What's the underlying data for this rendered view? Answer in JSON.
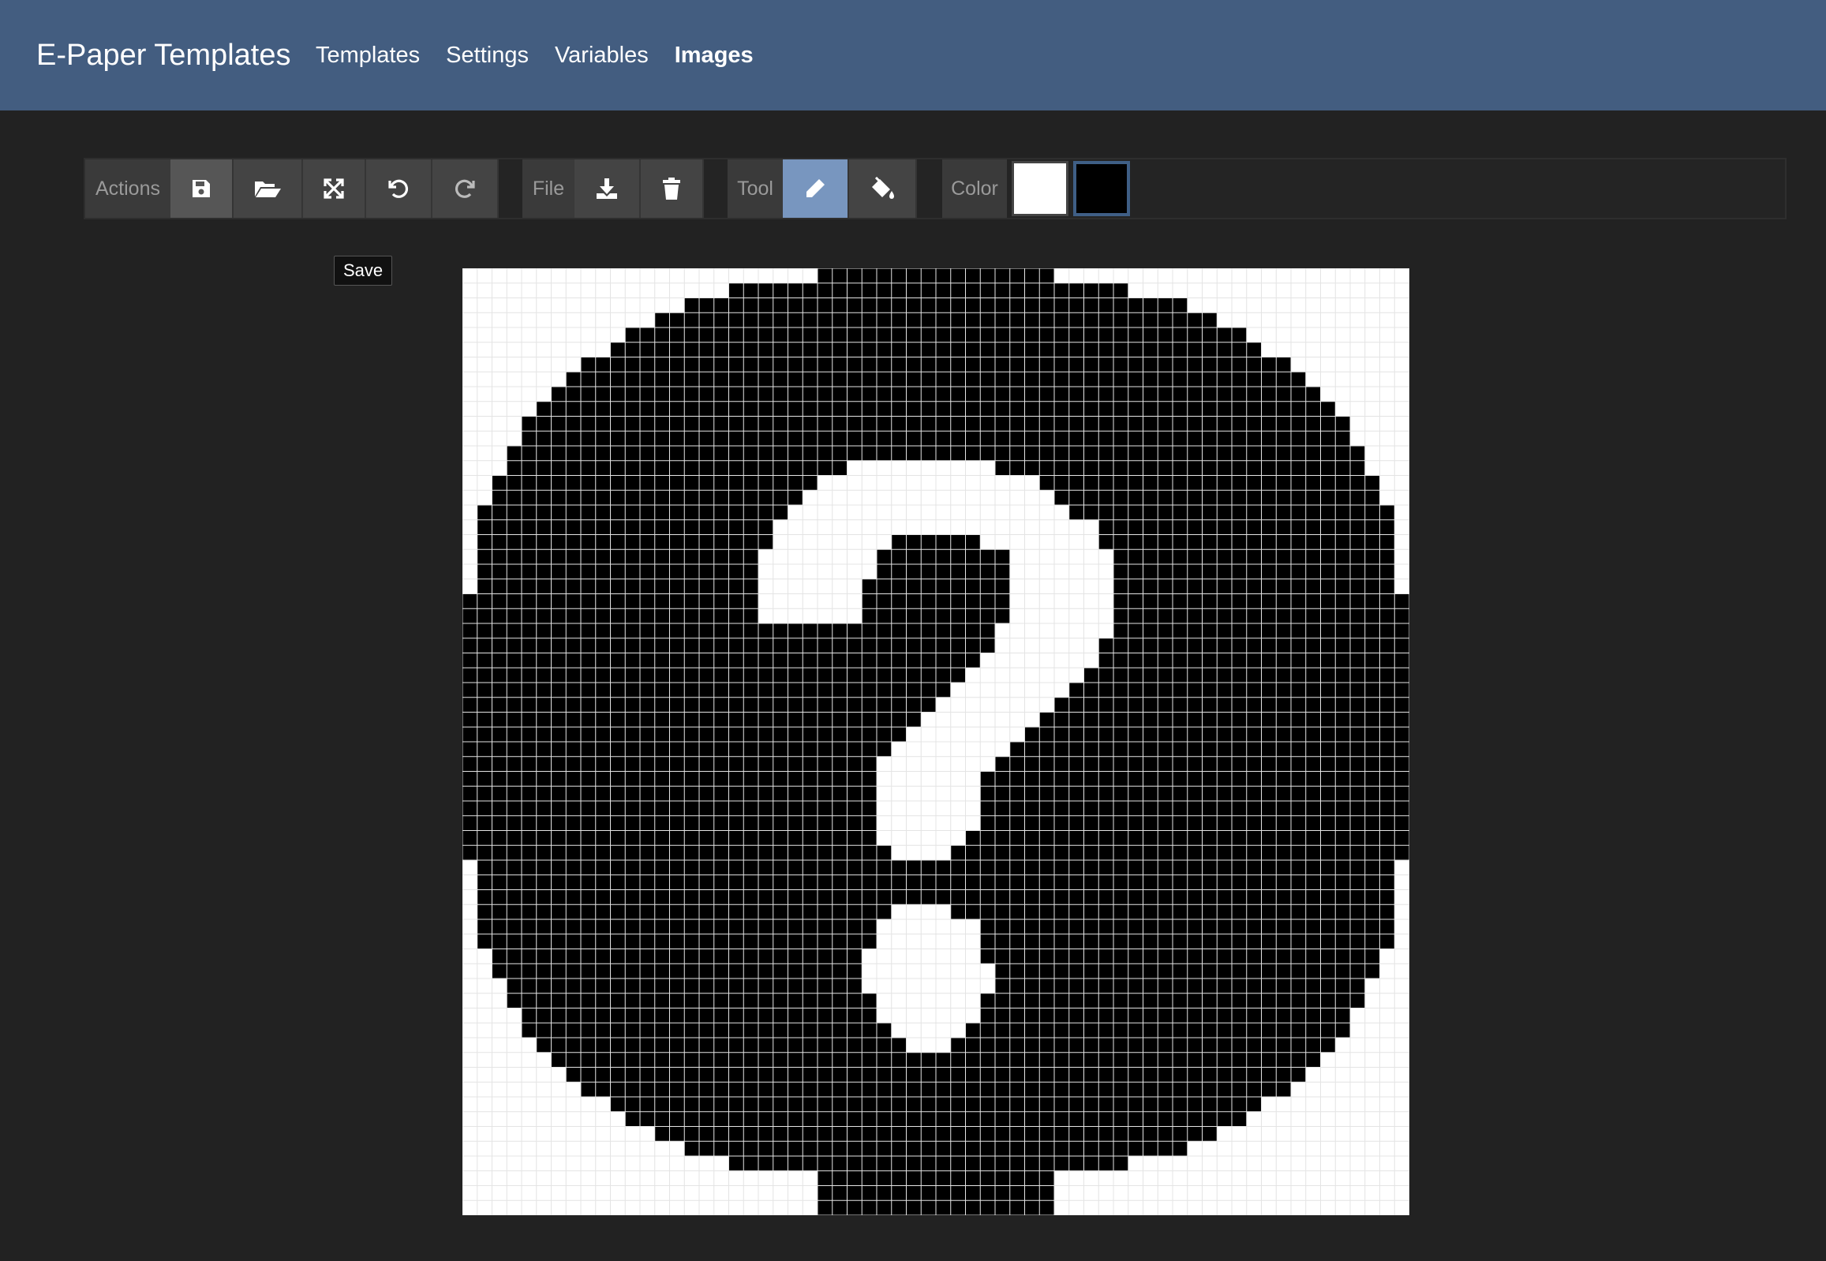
{
  "navbar": {
    "brand": "E-Paper Templates",
    "links": [
      {
        "label": "Templates",
        "active": false
      },
      {
        "label": "Settings",
        "active": false
      },
      {
        "label": "Variables",
        "active": false
      },
      {
        "label": "Images",
        "active": true
      }
    ]
  },
  "toolbar": {
    "actions_label": "Actions",
    "actions": [
      {
        "icon": "save-icon",
        "tooltip": "Save",
        "pressed": true
      },
      {
        "icon": "folder-open-icon"
      },
      {
        "icon": "expand-icon"
      },
      {
        "icon": "undo-icon"
      },
      {
        "icon": "redo-icon"
      }
    ],
    "file_label": "File",
    "file": [
      {
        "icon": "download-icon"
      },
      {
        "icon": "trash-icon"
      }
    ],
    "tool_label": "Tool",
    "tools": [
      {
        "icon": "pencil-icon",
        "selected": true
      },
      {
        "icon": "paint-bucket-icon",
        "selected": false
      }
    ],
    "color_label": "Color",
    "colors": [
      {
        "value": "#ffffff",
        "selected": false
      },
      {
        "value": "#000000",
        "selected": true
      }
    ]
  },
  "tooltip": {
    "text": "Save"
  },
  "image": {
    "width": 64,
    "height": 64,
    "palette": {
      "on": "#000000",
      "off": "#ffffff",
      "grid": "#e4e4e4"
    },
    "circle_rows": [
      [
        24,
        39
      ],
      [
        18,
        44
      ],
      [
        15,
        48
      ],
      [
        13,
        50
      ],
      [
        11,
        52
      ],
      [
        10,
        53
      ],
      [
        8,
        55
      ],
      [
        7,
        56
      ],
      [
        6,
        57
      ],
      [
        5,
        58
      ],
      [
        4,
        59
      ],
      [
        4,
        59
      ],
      [
        3,
        60
      ],
      [
        3,
        60
      ],
      [
        2,
        61
      ],
      [
        2,
        61
      ],
      [
        1,
        62
      ],
      [
        1,
        62
      ],
      [
        1,
        62
      ],
      [
        1,
        62
      ],
      [
        1,
        62
      ],
      [
        1,
        62
      ],
      [
        0,
        63
      ],
      [
        0,
        63
      ],
      [
        0,
        63
      ],
      [
        0,
        63
      ],
      [
        0,
        63
      ],
      [
        0,
        63
      ],
      [
        0,
        63
      ],
      [
        0,
        63
      ],
      [
        0,
        63
      ],
      [
        0,
        63
      ],
      [
        0,
        63
      ],
      [
        0,
        63
      ],
      [
        0,
        63
      ],
      [
        0,
        63
      ],
      [
        0,
        63
      ],
      [
        0,
        63
      ],
      [
        0,
        63
      ],
      [
        0,
        63
      ],
      [
        1,
        62
      ],
      [
        1,
        62
      ],
      [
        1,
        62
      ],
      [
        1,
        62
      ],
      [
        1,
        62
      ],
      [
        1,
        62
      ],
      [
        2,
        61
      ],
      [
        2,
        61
      ],
      [
        3,
        60
      ],
      [
        3,
        60
      ],
      [
        4,
        59
      ],
      [
        4,
        59
      ],
      [
        5,
        58
      ],
      [
        6,
        57
      ],
      [
        7,
        56
      ],
      [
        8,
        55
      ],
      [
        10,
        53
      ],
      [
        11,
        52
      ],
      [
        13,
        50
      ],
      [
        15,
        48
      ],
      [
        18,
        44
      ],
      [
        24,
        39
      ],
      [
        24,
        39
      ],
      [
        24,
        39
      ]
    ],
    "glyph_white": {
      "13": [
        [
          26,
          35
        ]
      ],
      "14": [
        [
          24,
          38
        ]
      ],
      "15": [
        [
          23,
          39
        ]
      ],
      "16": [
        [
          22,
          40
        ]
      ],
      "17": [
        [
          21,
          42
        ]
      ],
      "18": [
        [
          21,
          28
        ],
        [
          35,
          42
        ]
      ],
      "19": [
        [
          20,
          27
        ],
        [
          37,
          43
        ]
      ],
      "20": [
        [
          20,
          27
        ],
        [
          37,
          43
        ]
      ],
      "21": [
        [
          20,
          26
        ],
        [
          37,
          43
        ]
      ],
      "22": [
        [
          20,
          26
        ],
        [
          37,
          43
        ]
      ],
      "23": [
        [
          20,
          26
        ],
        [
          37,
          43
        ]
      ],
      "24": [
        [
          36,
          43
        ]
      ],
      "25": [
        [
          36,
          42
        ]
      ],
      "26": [
        [
          35,
          42
        ]
      ],
      "27": [
        [
          34,
          41
        ]
      ],
      "28": [
        [
          33,
          40
        ]
      ],
      "29": [
        [
          32,
          39
        ]
      ],
      "30": [
        [
          31,
          38
        ]
      ],
      "31": [
        [
          30,
          37
        ]
      ],
      "32": [
        [
          29,
          36
        ]
      ],
      "33": [
        [
          28,
          35
        ]
      ],
      "34": [
        [
          28,
          34
        ]
      ],
      "35": [
        [
          28,
          34
        ]
      ],
      "36": [
        [
          28,
          34
        ]
      ],
      "37": [
        [
          28,
          34
        ]
      ],
      "38": [
        [
          28,
          33
        ]
      ],
      "39": [
        [
          29,
          32
        ]
      ],
      "43": [
        [
          29,
          32
        ]
      ],
      "44": [
        [
          28,
          34
        ]
      ],
      "45": [
        [
          28,
          34
        ]
      ],
      "46": [
        [
          27,
          34
        ]
      ],
      "47": [
        [
          27,
          35
        ]
      ],
      "48": [
        [
          27,
          35
        ]
      ],
      "49": [
        [
          28,
          34
        ]
      ],
      "50": [
        [
          28,
          34
        ]
      ],
      "51": [
        [
          29,
          33
        ]
      ],
      "52": [
        [
          30,
          32
        ]
      ]
    }
  }
}
